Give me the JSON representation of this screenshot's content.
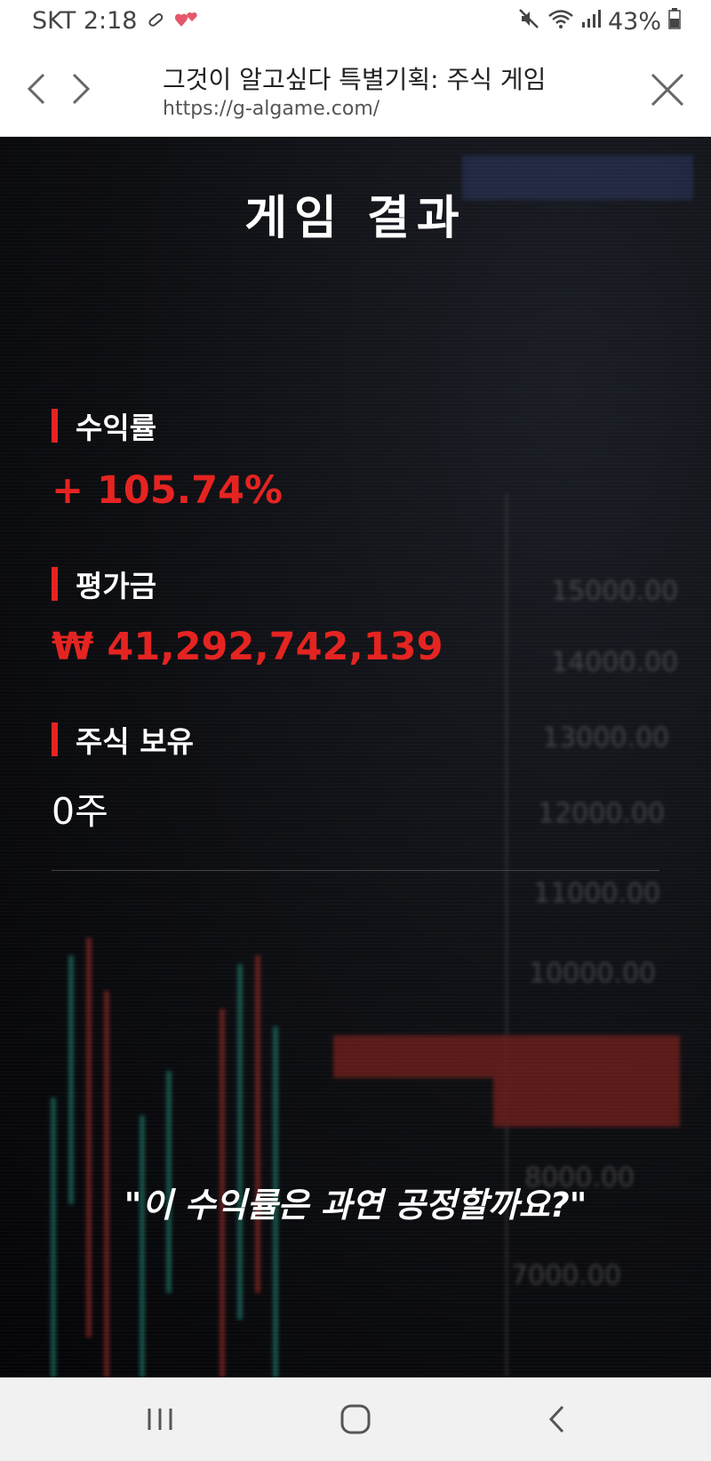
{
  "status_bar": {
    "carrier_time": "SKT 2:18",
    "battery": "43%",
    "icons": [
      "pill-icon",
      "hearts-icon",
      "mute-icon",
      "wifi-icon",
      "signal-icon",
      "battery-icon"
    ]
  },
  "browser": {
    "title": "그것이 알고싶다 특별기획: 주식 게임",
    "url": "https://g-algame.com/"
  },
  "main": {
    "heading": "게임 결과",
    "stats": [
      {
        "label": "수익률",
        "value": "+ 105.74%"
      },
      {
        "label": "평가금",
        "value": "₩ 41,292,742,139"
      },
      {
        "label": "주식 보유",
        "value": "0주"
      }
    ],
    "quote": "\"이 수익률은 과연 공정할까요?\""
  },
  "colors": {
    "accent_red": "#e52421",
    "background": "#0d0e12",
    "text": "#ffffff"
  }
}
